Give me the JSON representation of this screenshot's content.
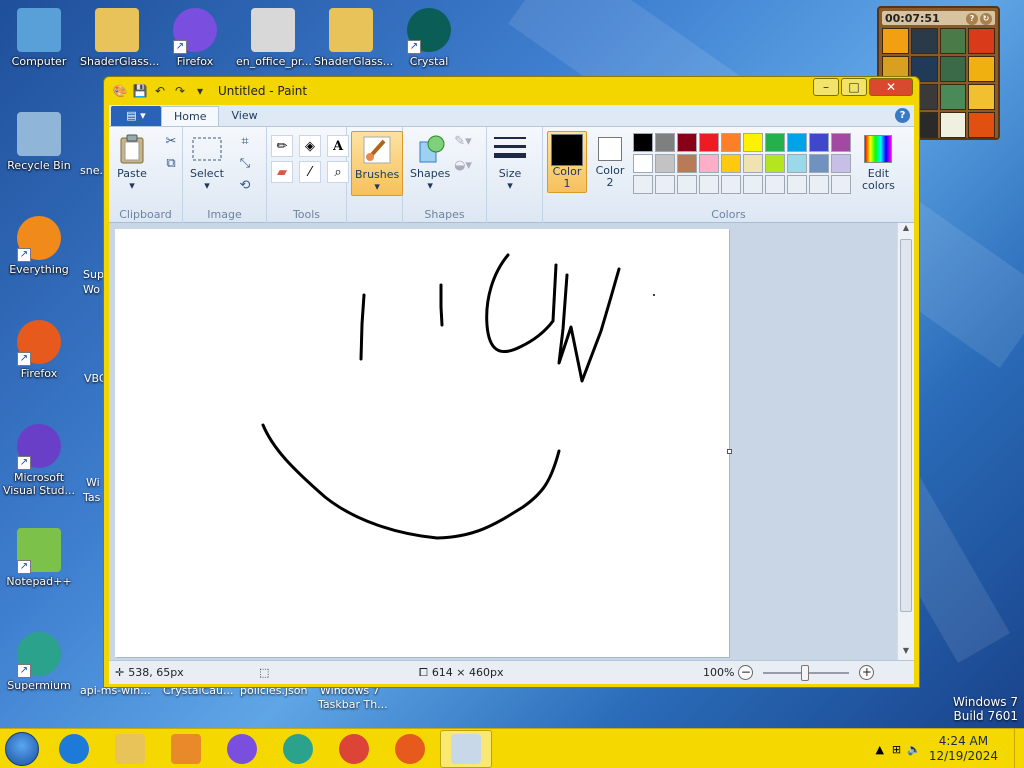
{
  "desktop": {
    "icons": [
      {
        "label": "Computer",
        "icon": "computer-icon",
        "color": "#5aa0d8"
      },
      {
        "label": "ShaderGlass...",
        "icon": "folder-icon",
        "color": "#e8c35a"
      },
      {
        "label": "Firefox",
        "icon": "firefox-icon",
        "color": "#7a4fe0"
      },
      {
        "label": "en_office_pr...",
        "icon": "disc-image-icon",
        "color": "#d8d8d8"
      },
      {
        "label": "ShaderGlass...",
        "icon": "zip-folder-icon",
        "color": "#e8c35a"
      },
      {
        "label": "Crystal",
        "icon": "crystal-icon",
        "color": "#0b5e57"
      },
      {
        "label": "Recycle Bin",
        "icon": "recycle-bin-icon",
        "color": "#8fb6d8"
      },
      {
        "label": "Everything",
        "icon": "everything-icon",
        "color": "#f08a1a"
      },
      {
        "label": "Firefox",
        "icon": "firefox-icon",
        "color": "#e65a1e"
      },
      {
        "label": "Microsoft Visual Stud...",
        "icon": "visual-studio-icon",
        "color": "#6a3fc8"
      },
      {
        "label": "Notepad++",
        "icon": "notepad-plus-icon",
        "color": "#7cc24a"
      },
      {
        "label": "Supermium",
        "icon": "supermium-icon",
        "color": "#2aa28c"
      }
    ],
    "partial_labels": [
      "sne...",
      "Sup",
      "Wo",
      "VBC",
      "Wi",
      "Tas",
      "api-ms-win...",
      "CrystalCau...",
      "policies.json",
      "Windows 7",
      "Taskbar Th..."
    ],
    "watermark": {
      "line1": "Windows 7",
      "line2": "Build 7601"
    }
  },
  "gadget": {
    "time": "00:07:51",
    "tile_colors": [
      "#f0a010",
      "#2a3a48",
      "#4a7a48",
      "#d83a1a",
      "#d8a020",
      "#203a58",
      "#3a6a48",
      "#f0b010",
      "#d86a10",
      "#3a3a3a",
      "#4a8a58",
      "#f0c030",
      "#e0b870",
      "#2a2a2a",
      "#f0f0e0",
      "#e05010"
    ]
  },
  "paint": {
    "title": "Untitled - Paint",
    "tabs": {
      "home": "Home",
      "view": "View"
    },
    "groups": {
      "clipboard": {
        "label": "Clipboard",
        "paste": "Paste"
      },
      "image": {
        "label": "Image",
        "select": "Select"
      },
      "tools": {
        "label": "Tools"
      },
      "brushes": {
        "label": "Brushes"
      },
      "shapes": {
        "label": "Shapes",
        "shapes_btn": "Shapes"
      },
      "size": {
        "label": "Size"
      },
      "colors": {
        "label": "Colors",
        "color1_line1": "Color",
        "color1_line2": "1",
        "color2_line1": "Color",
        "color2_line2": "2",
        "edit_line1": "Edit",
        "edit_line2": "colors",
        "color1_value": "#000000",
        "color2_value": "#ffffff",
        "palette": [
          "#000000",
          "#7f7f7f",
          "#880015",
          "#ed1c24",
          "#ff7f27",
          "#fff200",
          "#22b14c",
          "#00a2e8",
          "#3f48cc",
          "#a349a4",
          "#ffffff",
          "#c3c3c3",
          "#b97a57",
          "#ffaec9",
          "#ffc90e",
          "#efe4b0",
          "#b5e61d",
          "#99d9ea",
          "#7092be",
          "#c8bfe7",
          "#eaeff6",
          "#eaeff6",
          "#eaeff6",
          "#eaeff6",
          "#eaeff6",
          "#eaeff6",
          "#eaeff6",
          "#eaeff6",
          "#eaeff6",
          "#eaeff6"
        ]
      }
    },
    "status": {
      "cursor_pos": "538, 65px",
      "image_size": "614 × 460px",
      "zoom": "100%"
    }
  },
  "taskbar": {
    "items": [
      {
        "name": "internet-explorer",
        "color": "#1e7ad8"
      },
      {
        "name": "file-explorer",
        "color": "#e8c35a"
      },
      {
        "name": "media-player",
        "color": "#e88a2a"
      },
      {
        "name": "firefox",
        "color": "#7a4fe0"
      },
      {
        "name": "supermium",
        "color": "#2aa28c"
      },
      {
        "name": "chrome",
        "color": "#db4437"
      },
      {
        "name": "firefox",
        "color": "#e65a1e"
      },
      {
        "name": "paint",
        "color": "#c8d8e8"
      }
    ],
    "clock": {
      "time": "4:24 AM",
      "date": "12/19/2024"
    }
  }
}
